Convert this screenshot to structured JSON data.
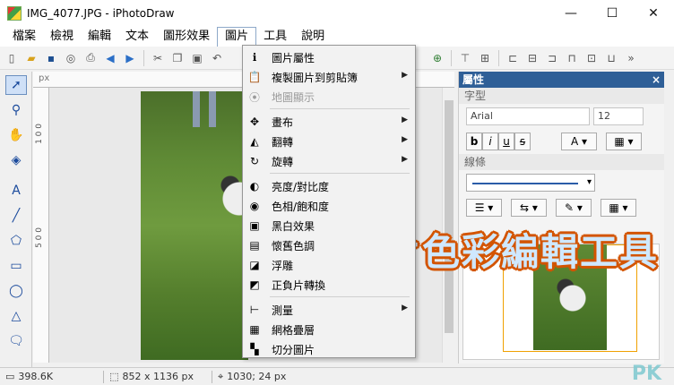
{
  "window": {
    "title": "IMG_4077.JPG - iPhotoDraw",
    "min_label": "—",
    "max_label": "☐",
    "close_label": "✕"
  },
  "menubar": {
    "items": [
      "檔案",
      "檢視",
      "編輯",
      "文本",
      "圖形效果",
      "圖片",
      "工具",
      "說明"
    ],
    "active": "圖片"
  },
  "canvas": {
    "ruler_unit": "px",
    "ruler_left_marks": [
      "1 0 0",
      "5 0 0"
    ]
  },
  "panel": {
    "title": "屬性",
    "close": "×",
    "section_font": "字型",
    "font_name": "Arial",
    "font_size": "12",
    "bold": "b",
    "italic": "i",
    "underline": "u",
    "strike": "s",
    "text_color_btn": "A",
    "section_line": "線條"
  },
  "dropdown": {
    "items": [
      {
        "label": "圖片屬性",
        "icon": "info-icon",
        "glyph": "ℹ",
        "has_sub": false,
        "disabled": false
      },
      {
        "label": "複製圖片到剪貼簿",
        "icon": "clipboard-icon",
        "glyph": "📋",
        "has_sub": true,
        "disabled": false
      },
      {
        "label": "地圖顯示",
        "icon": "map-pin-icon",
        "glyph": "⦿",
        "has_sub": false,
        "disabled": true
      },
      {
        "label": "畫布",
        "icon": "canvas-icon",
        "glyph": "✥",
        "has_sub": true,
        "disabled": false
      },
      {
        "label": "翻轉",
        "icon": "flip-icon",
        "glyph": "◭",
        "has_sub": true,
        "disabled": false
      },
      {
        "label": "旋轉",
        "icon": "rotate-icon",
        "glyph": "↻",
        "has_sub": true,
        "disabled": false
      },
      {
        "label": "亮度/對比度",
        "icon": "brightness-icon",
        "glyph": "◐",
        "has_sub": false,
        "disabled": false
      },
      {
        "label": "色相/飽和度",
        "icon": "hue-icon",
        "glyph": "◉",
        "has_sub": false,
        "disabled": false
      },
      {
        "label": "黑白效果",
        "icon": "grayscale-icon",
        "glyph": "▣",
        "has_sub": false,
        "disabled": false
      },
      {
        "label": "懷舊色調",
        "icon": "sepia-icon",
        "glyph": "▤",
        "has_sub": false,
        "disabled": false
      },
      {
        "label": "浮雕",
        "icon": "emboss-icon",
        "glyph": "◪",
        "has_sub": false,
        "disabled": false
      },
      {
        "label": "正負片轉換",
        "icon": "invert-icon",
        "glyph": "◩",
        "has_sub": false,
        "disabled": false
      },
      {
        "label": "測量",
        "icon": "measure-icon",
        "glyph": "⊢",
        "has_sub": true,
        "disabled": false
      },
      {
        "label": "網格疊層",
        "icon": "grid-icon",
        "glyph": "▦",
        "has_sub": false,
        "disabled": false
      },
      {
        "label": "切分圖片",
        "icon": "split-icon",
        "glyph": "▚",
        "has_sub": false,
        "disabled": false
      }
    ]
  },
  "overlay_caption": "圖片色彩編輯工具",
  "statusbar": {
    "file_size": "398.6K",
    "dimensions": "852 x 1136 px",
    "cursor": "1030; 24 px"
  },
  "watermark": "PK"
}
